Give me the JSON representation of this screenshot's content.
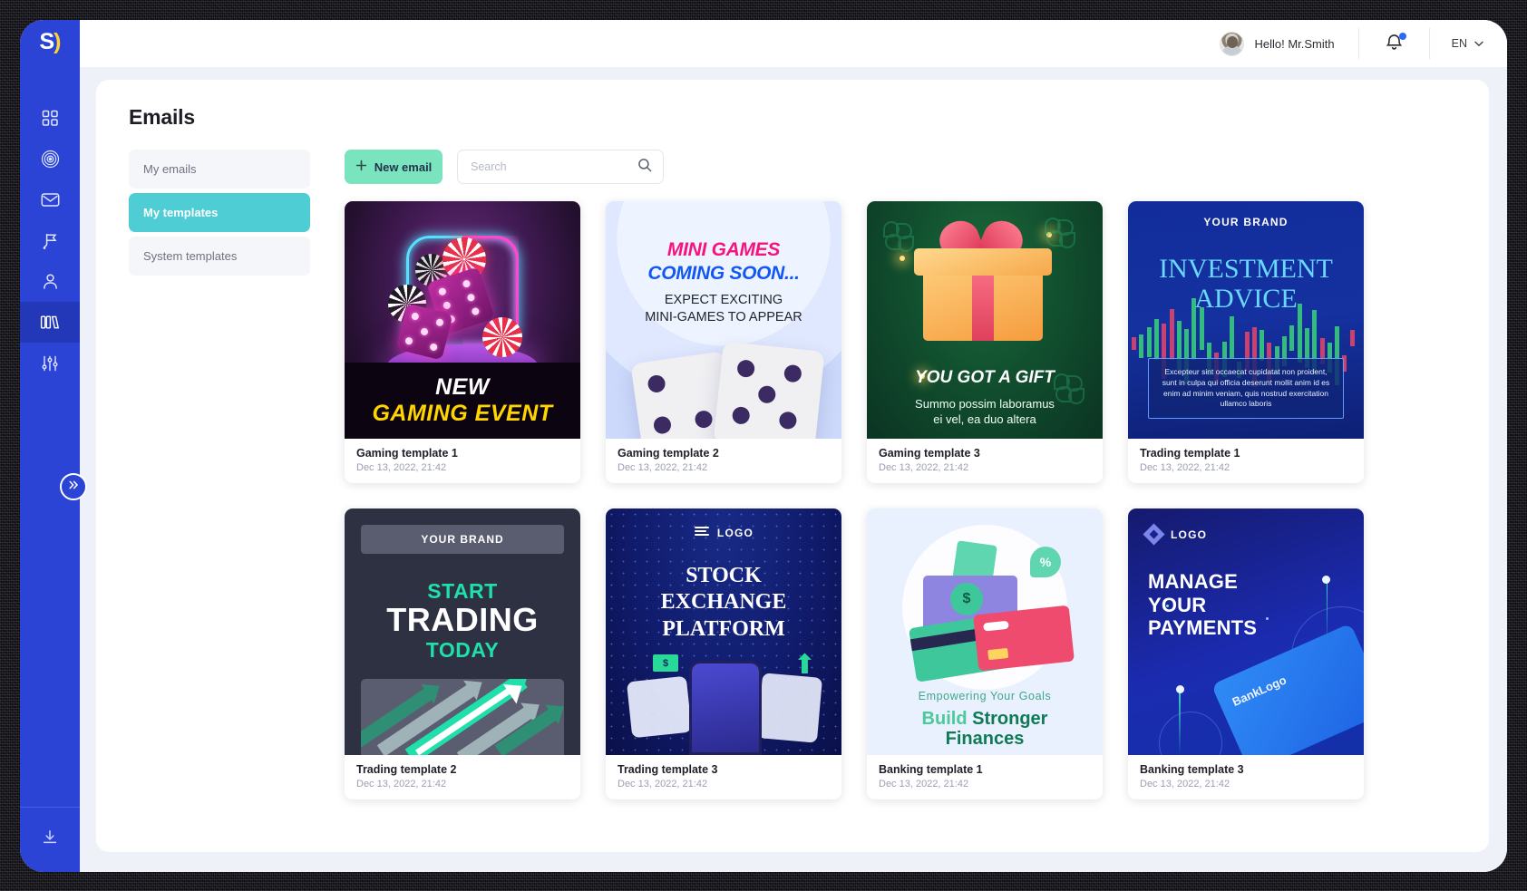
{
  "brand": {
    "logo_text": "S",
    "logo_accent": ")"
  },
  "sidebar": {
    "items": [
      {
        "name": "dashboard",
        "icon": "grid-icon"
      },
      {
        "name": "campaigns",
        "icon": "target-icon"
      },
      {
        "name": "emails",
        "icon": "mail-icon"
      },
      {
        "name": "goals",
        "icon": "flag-icon"
      },
      {
        "name": "audience",
        "icon": "person-icon"
      },
      {
        "name": "templates",
        "icon": "books-icon",
        "active": true
      },
      {
        "name": "settings",
        "icon": "sliders-icon"
      }
    ],
    "expand_icon": "chevron-double-right-icon",
    "bottom_icon": "download-icon"
  },
  "topbar": {
    "greeting": "Hello! Mr.Smith",
    "notifications_icon": "bell-icon",
    "language": "EN",
    "chevron": "˅"
  },
  "page": {
    "title": "Emails"
  },
  "subnav": {
    "items": [
      {
        "label": "My emails",
        "active": false
      },
      {
        "label": "My templates",
        "active": true
      },
      {
        "label": "System templates",
        "active": false
      }
    ]
  },
  "toolbar": {
    "new_email_label": "New email",
    "new_email_icon": "plus-icon",
    "search_placeholder": "Search",
    "search_value": "",
    "search_icon": "search-icon"
  },
  "colors": {
    "sidebar": "#2b44d6",
    "accent_teal": "#4ecdd4",
    "accent_mint": "#79e4bd",
    "panel_bg": "#ffffff",
    "app_bg": "#eef1f7"
  },
  "templates": [
    {
      "title": "Gaming template 1",
      "date": "Dec 13, 2022, 21:42",
      "art": {
        "kind": "gaming-neon-dice",
        "headline_1": "NEW",
        "headline_2": "GAMING EVENT"
      }
    },
    {
      "title": "Gaming template 2",
      "date": "Dec 13, 2022, 21:42",
      "art": {
        "kind": "mini-games-dice",
        "headline_1": "MINI GAMES",
        "headline_2": "COMING SOON...",
        "sub_1": "EXPECT EXCITING",
        "sub_2": "MINI-GAMES TO APPEAR"
      }
    },
    {
      "title": "Gaming template 3",
      "date": "Dec 13, 2022, 21:42",
      "art": {
        "kind": "gift-clover",
        "headline": "YOU GOT A GIFT",
        "sub_1": "Summo possim laboramus",
        "sub_2": "ei vel, ea duo altera"
      }
    },
    {
      "title": "Trading template 1",
      "date": "Dec 13, 2022, 21:42",
      "art": {
        "kind": "investment-candles",
        "brand": "YOUR BRAND",
        "headline_1": "INVESTMENT",
        "headline_2": "ADVICE",
        "body": "Excepteur sint occaecat cupidatat non proident, sunt in culpa qui officia deserunt mollit anim id es enim ad minim veniam, quis nostrud exercitation ullamco laboris"
      }
    },
    {
      "title": "Trading template 2",
      "date": "Dec 13, 2022, 21:42",
      "art": {
        "kind": "start-trading-arrows",
        "brand": "YOUR BRAND",
        "headline_1": "START",
        "headline_2": "TRADING",
        "headline_3": "TODAY"
      }
    },
    {
      "title": "Trading template 3",
      "date": "Dec 13, 2022, 21:42",
      "art": {
        "kind": "stock-exchange-phone",
        "logo": "LOGO",
        "logo_icon": "hamburger-icon",
        "headline_1": "STOCK",
        "headline_2": "EXCHANGE",
        "headline_3": "PLATFORM",
        "bill_symbol": "$"
      }
    },
    {
      "title": "Banking template 1",
      "date": "Dec 13, 2022, 21:42",
      "art": {
        "kind": "build-finances-cards",
        "sub": "Empowering Your Goals",
        "headline_1a": "Build",
        "headline_1b": "Stronger",
        "headline_2": "Finances",
        "coin_symbol": "$",
        "badge_symbol": "%"
      }
    },
    {
      "title": "Banking template 3",
      "date": "Dec 13, 2022, 21:42",
      "art": {
        "kind": "manage-payments-card",
        "logo": "LOGO",
        "logo_icon": "diamond-icon",
        "headline_1": "MANAGE",
        "headline_2": "YOUR",
        "headline_3": "PAYMENTS",
        "card_brand": "BankLogo"
      }
    }
  ]
}
